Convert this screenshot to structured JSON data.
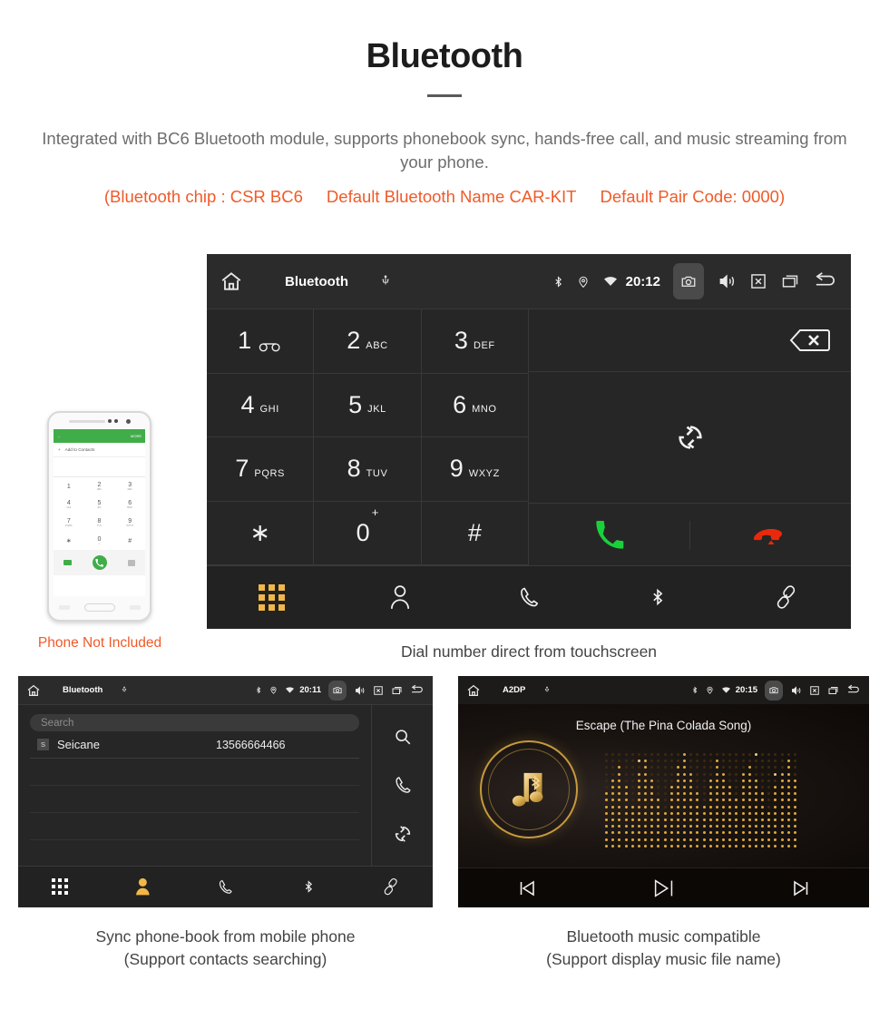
{
  "header": {
    "title": "Bluetooth",
    "intro": "Integrated with BC6 Bluetooth module, supports phonebook sync, hands-free call, and music streaming from your phone.",
    "note_open": "(Bluetooth chip : CSR BC6",
    "note_name": "Default Bluetooth Name CAR-KIT",
    "note_code": "Default Pair Code: 0000)",
    "note_color": "#f05a28"
  },
  "phone_mock": {
    "caption": "Phone Not Included",
    "green_bar_back": "←",
    "green_bar_more": "MORE",
    "add_contacts": "Add to Contacts",
    "plus": "+",
    "keys": [
      {
        "n": "1",
        "s": ""
      },
      {
        "n": "2",
        "s": "ABC"
      },
      {
        "n": "3",
        "s": "DEF"
      },
      {
        "n": "4",
        "s": "GHI"
      },
      {
        "n": "5",
        "s": "JKL"
      },
      {
        "n": "6",
        "s": "MNO"
      },
      {
        "n": "7",
        "s": "PQRS"
      },
      {
        "n": "8",
        "s": "TUV"
      },
      {
        "n": "9",
        "s": "WXYZ"
      },
      {
        "n": "∗",
        "s": ""
      },
      {
        "n": "0",
        "s": "+"
      },
      {
        "n": "#",
        "s": ""
      }
    ]
  },
  "dialer": {
    "statusbar": {
      "title": "Bluetooth",
      "time": "20:12",
      "icons": [
        "home-icon",
        "usb-icon",
        "bluetooth-icon",
        "location-icon",
        "wifi-icon",
        "camera-icon",
        "volume-icon",
        "close-icon",
        "recents-icon",
        "back-icon"
      ]
    },
    "keys": [
      {
        "num": "1",
        "sub": "",
        "voicemail": true
      },
      {
        "num": "2",
        "sub": "ABC"
      },
      {
        "num": "3",
        "sub": "DEF"
      },
      {
        "num": "4",
        "sub": "GHI"
      },
      {
        "num": "5",
        "sub": "JKL"
      },
      {
        "num": "6",
        "sub": "MNO"
      },
      {
        "num": "7",
        "sub": "PQRS"
      },
      {
        "num": "8",
        "sub": "TUV"
      },
      {
        "num": "9",
        "sub": "WXYZ"
      },
      {
        "num": "∗",
        "sub": ""
      },
      {
        "num": "0",
        "sub": "",
        "plus": "+"
      },
      {
        "num": "#",
        "sub": ""
      }
    ],
    "input_value": "",
    "actions": {
      "backspace": "backspace-icon",
      "sync": "sync-icon",
      "call": "call-answer-icon",
      "hangup": "call-end-icon",
      "call_color": "#18d13a",
      "hangup_color": "#e8290b"
    },
    "tabs": [
      {
        "name": "keypad",
        "icon": "keypad-icon",
        "active": true
      },
      {
        "name": "contacts",
        "icon": "person-icon",
        "active": false
      },
      {
        "name": "call-log",
        "icon": "handset-icon",
        "active": false
      },
      {
        "name": "bluetooth",
        "icon": "bluetooth-icon",
        "active": false
      },
      {
        "name": "pair-link",
        "icon": "link-icon",
        "active": false
      }
    ],
    "active_color": "#f2b749",
    "caption": "Dial number direct from touchscreen"
  },
  "phonebook": {
    "statusbar": {
      "title": "Bluetooth",
      "time": "20:11"
    },
    "search_placeholder": "Search",
    "contacts": [
      {
        "initial": "S",
        "name": "Seicane",
        "number": "13566664466"
      }
    ],
    "empty_rows": 3,
    "side_actions": [
      {
        "name": "search",
        "icon": "search-icon"
      },
      {
        "name": "call",
        "icon": "handset-icon"
      },
      {
        "name": "sync",
        "icon": "sync-icon"
      }
    ],
    "tabs": [
      {
        "name": "keypad",
        "icon": "keypad-icon",
        "active": false
      },
      {
        "name": "contacts",
        "icon": "person-icon",
        "active": true
      },
      {
        "name": "call-log",
        "icon": "handset-icon",
        "active": false
      },
      {
        "name": "bluetooth",
        "icon": "bluetooth-icon",
        "active": false
      },
      {
        "name": "pair-link",
        "icon": "link-icon",
        "active": false
      }
    ],
    "caption_line1": "Sync phone-book from mobile phone",
    "caption_line2": "(Support contacts searching)"
  },
  "a2dp": {
    "statusbar": {
      "title": "A2DP",
      "time": "20:15"
    },
    "song_title": "Escape (The Pina Colada Song)",
    "album_art_icon": "music-note-bluetooth-icon",
    "accent_color": "#c79a3c",
    "controls": [
      {
        "name": "previous",
        "icon": "skip-previous-icon"
      },
      {
        "name": "play-pause",
        "icon": "play-pause-icon"
      },
      {
        "name": "next",
        "icon": "skip-next-icon"
      }
    ],
    "caption_line1": "Bluetooth music compatible",
    "caption_line2": "(Support display music file name)"
  }
}
